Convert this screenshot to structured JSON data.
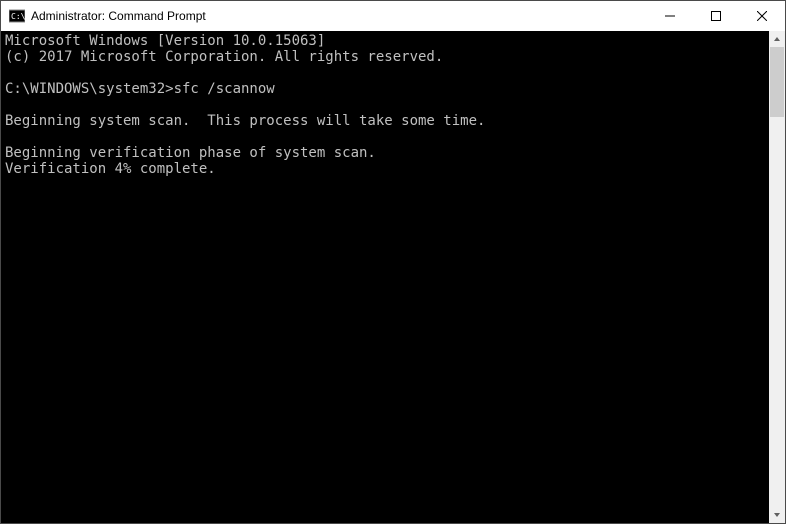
{
  "window": {
    "title": "Administrator: Command Prompt"
  },
  "terminal": {
    "lines": [
      "Microsoft Windows [Version 10.0.15063]",
      "(c) 2017 Microsoft Corporation. All rights reserved.",
      "",
      "C:\\WINDOWS\\system32>sfc /scannow",
      "",
      "Beginning system scan.  This process will take some time.",
      "",
      "Beginning verification phase of system scan.",
      "Verification 4% complete."
    ]
  }
}
